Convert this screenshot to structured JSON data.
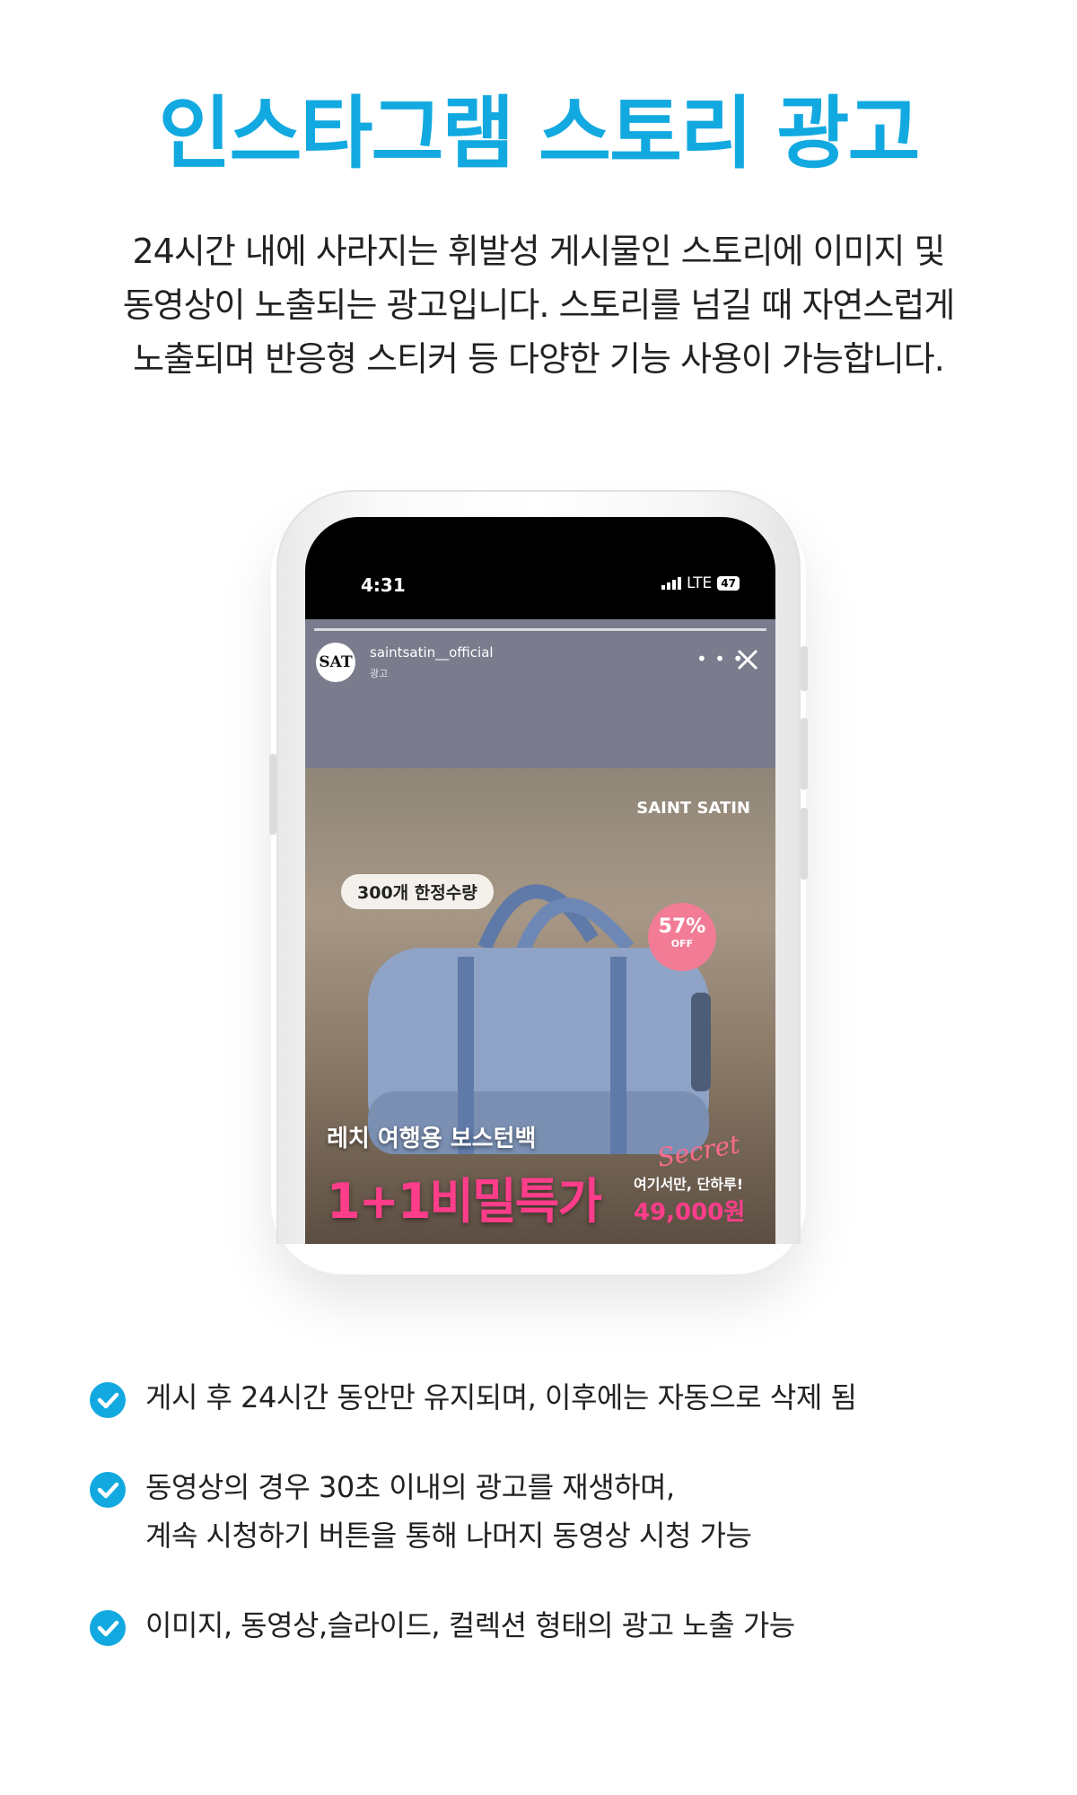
{
  "title": "인스타그램 스토리 광고",
  "intro": [
    "24시간 내에 사라지는 휘발성 게시물인 스토리에 이미지 및",
    "동영상이 노출되는 광고입니다. 스토리를 넘길 때 자연스럽게",
    "노출되며 반응형 스티커 등 다양한 기능 사용이 가능합니다."
  ],
  "phone": {
    "status": {
      "time": "4:31",
      "network": "LTE",
      "battery": "47"
    },
    "story": {
      "account_name": "saintsatin__official",
      "account_sub": "광고",
      "avatar_text": "SAT",
      "ad": {
        "brand": "SAINT SATIN",
        "bubble": "300개 한정수량",
        "badge_pct": "57%",
        "badge_off": "OFF",
        "headline_sub": "레치 여행용 보스턴백",
        "headline_main": "1+1비밀특가",
        "script_text": "Secret",
        "price_sub": "여기서만, 단하루!",
        "price": "49,000원"
      }
    }
  },
  "features": [
    {
      "lines": [
        "게시 후 24시간 동안만 유지되며, 이후에는 자동으로 삭제 됨"
      ]
    },
    {
      "lines": [
        "동영상의 경우 30초 이내의 광고를 재생하며,",
        "계속 시청하기 버튼을 통해 나머지 동영상 시청 가능"
      ]
    },
    {
      "lines": [
        "이미지, 동영상,슬라이드, 컬렉션 형태의 광고 노출 가능"
      ]
    }
  ],
  "colors": {
    "accent": "#12a9e0",
    "check": "#12a9e0",
    "sale_pink": "#ff3d8a"
  }
}
